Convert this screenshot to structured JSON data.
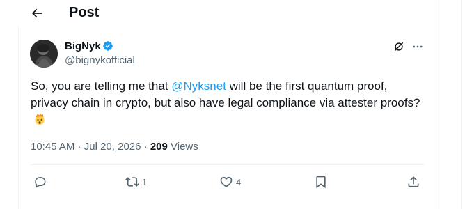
{
  "header": {
    "back_icon": "arrow-left-icon",
    "title": "Post"
  },
  "author": {
    "name": "BigNyk",
    "handle": "@bignykofficial",
    "verified": true,
    "verified_color": "#1d9bf0"
  },
  "tweet": {
    "text_before": "So, you are telling me that ",
    "mention": "@Nyksnet",
    "text_after": " will be the first quantum proof, privacy chain in crypto, but also have legal compliance via attester proofs?",
    "emoji": "exploding-head-emoji"
  },
  "meta": {
    "time": "10:45 AM",
    "separator1": " · ",
    "date": "Jul 20, 2026",
    "separator2": " · ",
    "views_count": "209",
    "views_label": " Views"
  },
  "actions": {
    "reply_count": "",
    "retweet_count": "1",
    "like_count": "4",
    "bookmark_count": "",
    "share_count": ""
  },
  "colors": {
    "text": "#0f1419",
    "muted": "#536471",
    "accent": "#1d9bf0",
    "border": "#eff3f4"
  }
}
